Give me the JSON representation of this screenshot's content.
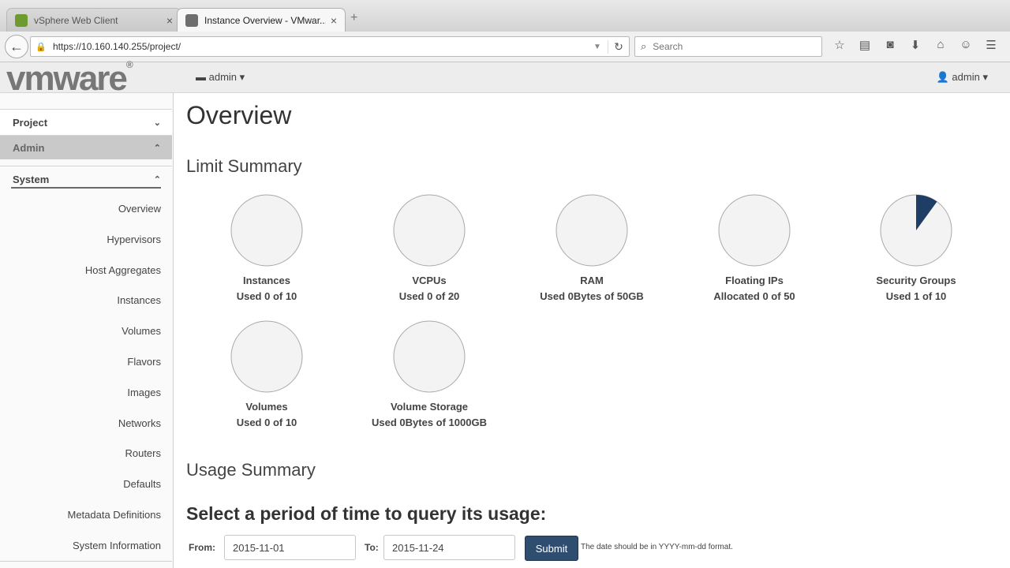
{
  "browser": {
    "tabs": [
      {
        "label": "vSphere Web Client",
        "active": false
      },
      {
        "label": "Instance Overview - VMwar...",
        "active": true
      }
    ],
    "url": "https://10.160.140.255/project/",
    "search_placeholder": "Search"
  },
  "header": {
    "logo": "vmware",
    "project_selector": "admin",
    "user_menu": "admin"
  },
  "sidebar": {
    "sections": {
      "project": "Project",
      "admin": "Admin",
      "system": "System"
    },
    "items": [
      {
        "label": "Overview"
      },
      {
        "label": "Hypervisors"
      },
      {
        "label": "Host Aggregates"
      },
      {
        "label": "Instances"
      },
      {
        "label": "Volumes"
      },
      {
        "label": "Flavors"
      },
      {
        "label": "Images"
      },
      {
        "label": "Networks"
      },
      {
        "label": "Routers"
      },
      {
        "label": "Defaults"
      },
      {
        "label": "Metadata Definitions"
      },
      {
        "label": "System Information"
      }
    ]
  },
  "main": {
    "title": "Overview",
    "limit_summary": "Limit Summary",
    "pies": [
      {
        "title": "Instances",
        "used_text": "Used 0 of 10",
        "fraction": 0
      },
      {
        "title": "VCPUs",
        "used_text": "Used 0 of 20",
        "fraction": 0
      },
      {
        "title": "RAM",
        "used_text": "Used 0Bytes of 50GB",
        "fraction": 0
      },
      {
        "title": "Floating IPs",
        "used_text": "Allocated 0 of 50",
        "fraction": 0
      },
      {
        "title": "Security Groups",
        "used_text": "Used 1 of 10",
        "fraction": 0.1
      },
      {
        "title": "Volumes",
        "used_text": "Used 0 of 10",
        "fraction": 0
      },
      {
        "title": "Volume Storage",
        "used_text": "Used 0Bytes of 1000GB",
        "fraction": 0
      }
    ],
    "usage_summary": "Usage Summary",
    "query_heading": "Select a period of time to query its usage:",
    "form": {
      "from_label": "From:",
      "from_value": "2015-11-01",
      "to_label": "To:",
      "to_value": "2015-11-24",
      "submit": "Submit",
      "hint": "The date should be in YYYY-mm-dd format."
    }
  },
  "colors": {
    "pie_fill": "#f3f3f3",
    "pie_used": "#1f3e66",
    "submit_bg": "#2f4d6e"
  }
}
